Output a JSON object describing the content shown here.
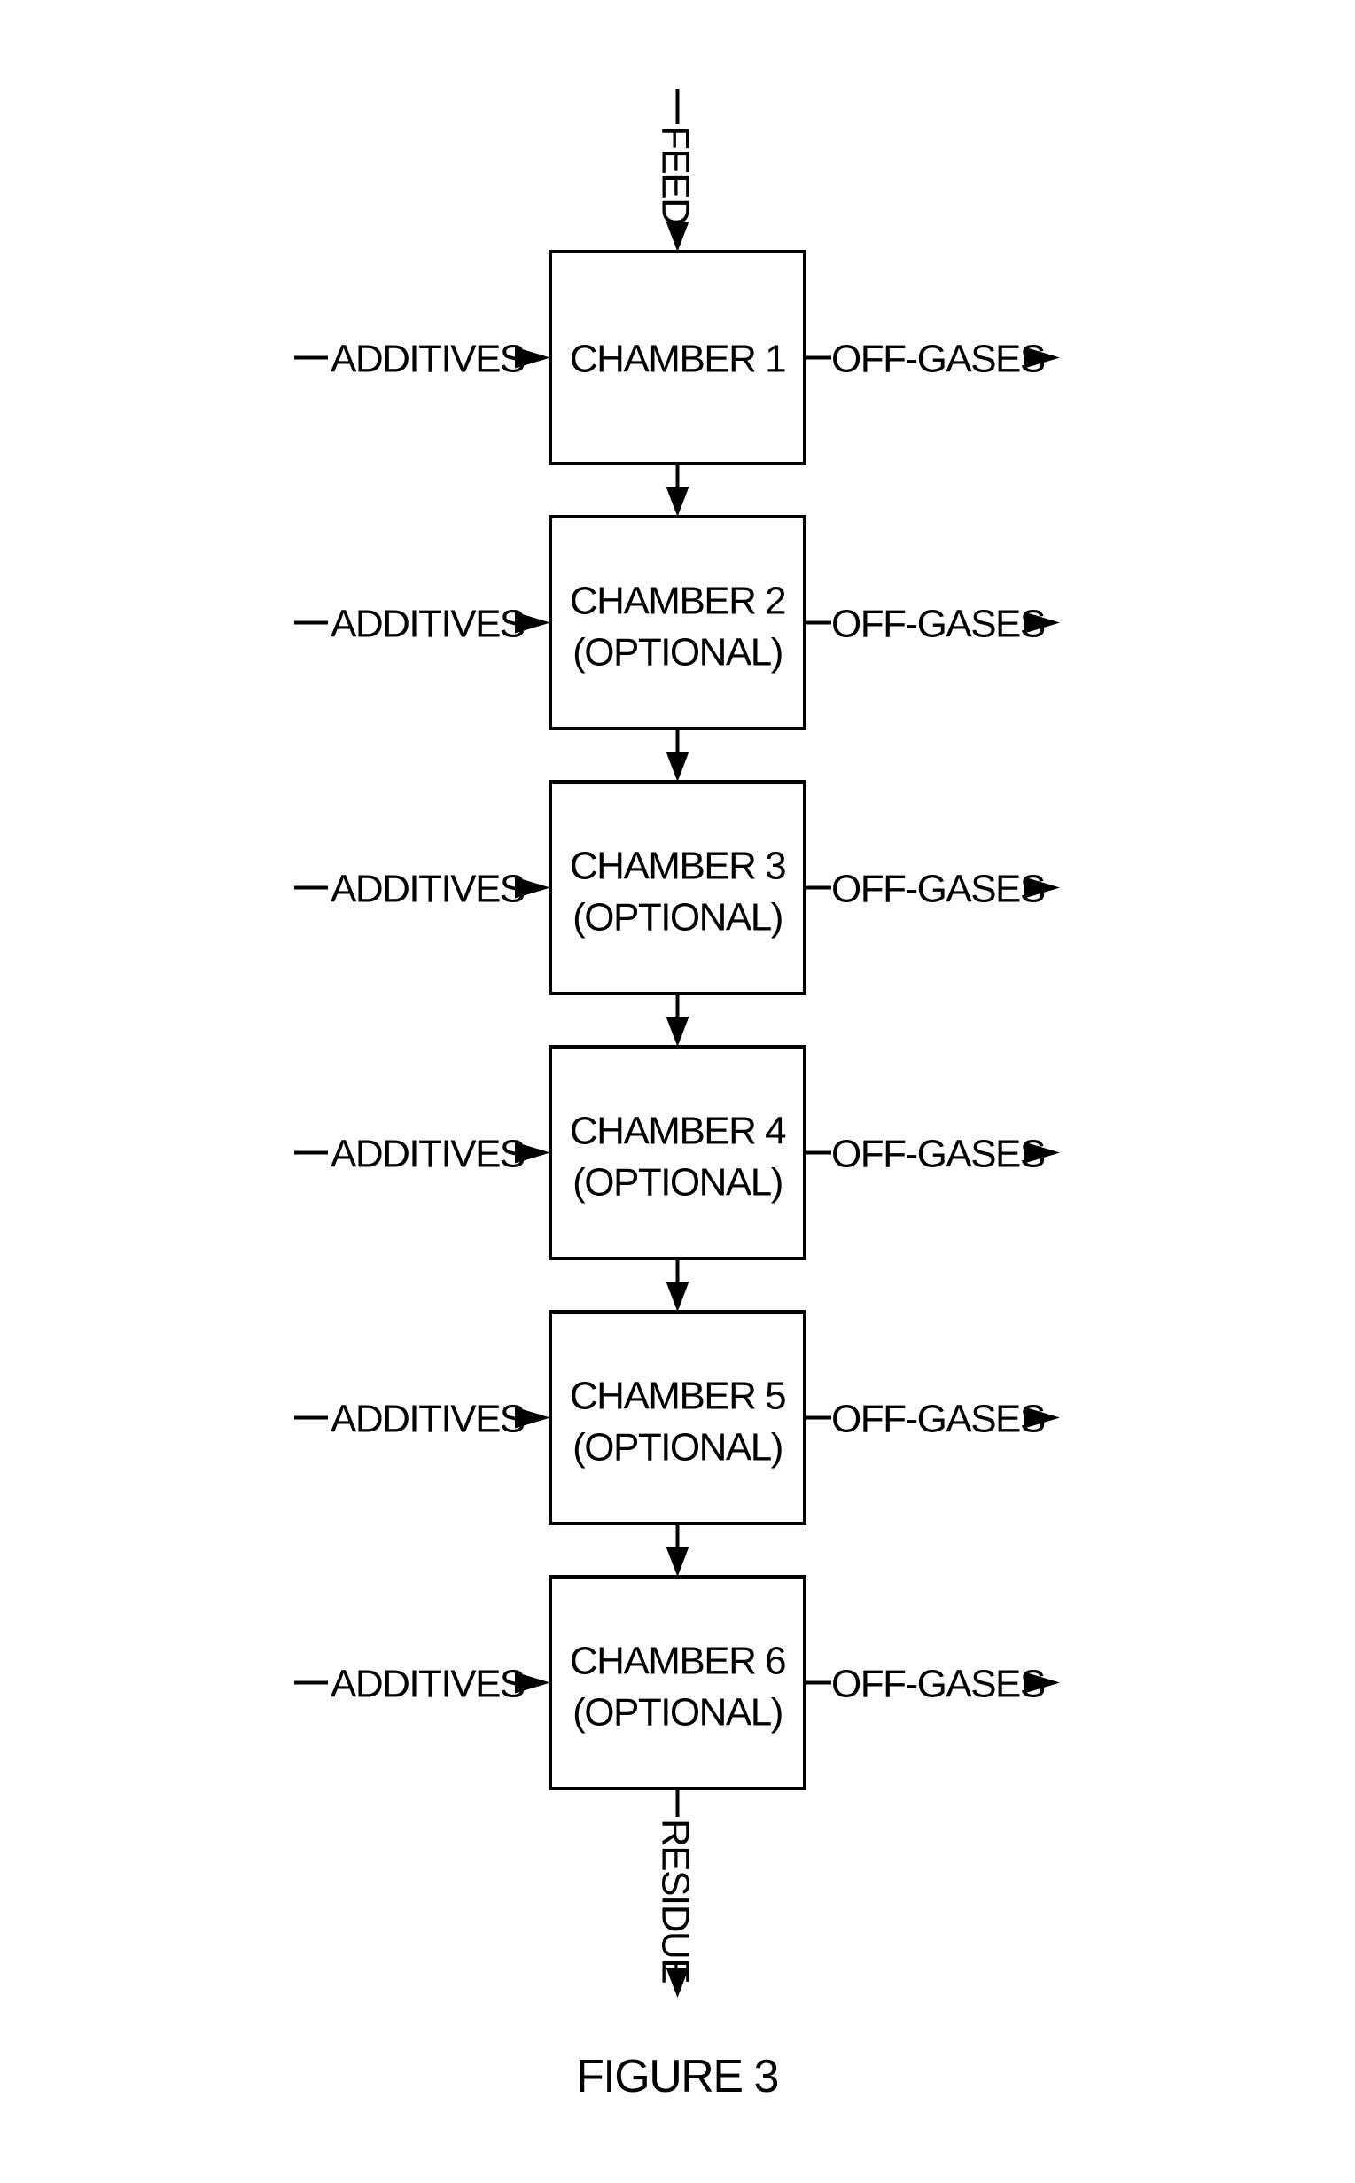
{
  "figure": {
    "caption": "FIGURE 3",
    "input_label": "FEED",
    "output_label": "RESIDUE",
    "side_input_label": "ADDITIVES",
    "side_output_label": "OFF-GASES",
    "chambers": [
      {
        "line1": "CHAMBER 1",
        "line2": ""
      },
      {
        "line1": "CHAMBER 2",
        "line2": "(OPTIONAL)"
      },
      {
        "line1": "CHAMBER 3",
        "line2": "(OPTIONAL)"
      },
      {
        "line1": "CHAMBER 4",
        "line2": "(OPTIONAL)"
      },
      {
        "line1": "CHAMBER 5",
        "line2": "(OPTIONAL)"
      },
      {
        "line1": "CHAMBER 6",
        "line2": "(OPTIONAL)"
      }
    ],
    "colors": {
      "line": "#000000",
      "background": "#ffffff"
    }
  }
}
